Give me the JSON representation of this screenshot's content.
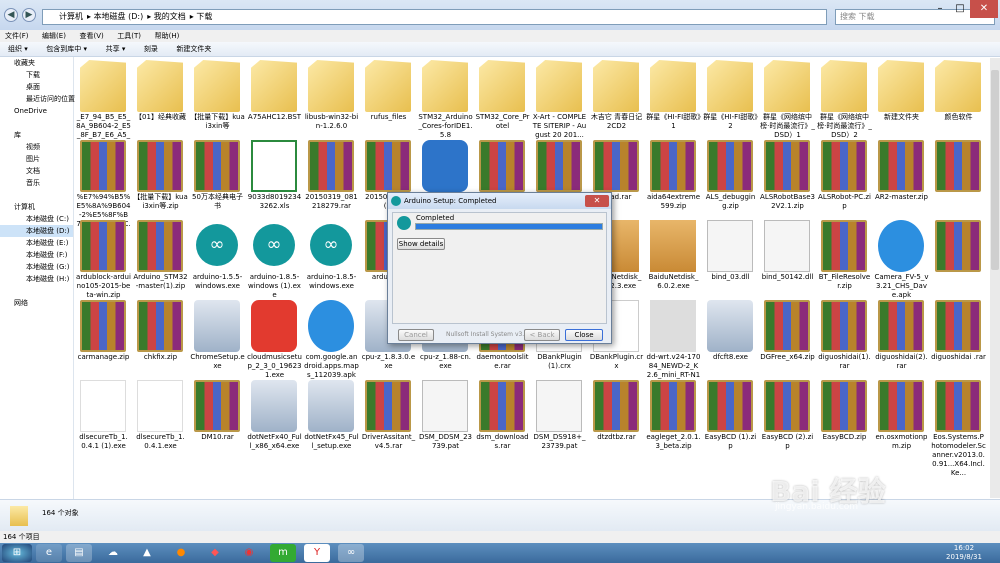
{
  "breadcrumb": [
    "计算机",
    "本地磁盘 (D:)",
    "我的文档",
    "下载"
  ],
  "search_placeholder": "搜索 下载",
  "menu": [
    "文件(F)",
    "编辑(E)",
    "查看(V)",
    "工具(T)",
    "帮助(H)"
  ],
  "toolbar": [
    "组织 ▾",
    "包含到库中 ▾",
    "共享 ▾",
    "刻录",
    "新建文件夹"
  ],
  "nav": [
    {
      "label": "收藏夹",
      "sub": false
    },
    {
      "label": "下载",
      "sub": true
    },
    {
      "label": "桌面",
      "sub": true
    },
    {
      "label": "最近访问的位置",
      "sub": true
    },
    {
      "label": "OneDrive",
      "sub": false
    },
    {
      "label": "",
      "sub": false
    },
    {
      "label": "库",
      "sub": false
    },
    {
      "label": "视频",
      "sub": true
    },
    {
      "label": "图片",
      "sub": true
    },
    {
      "label": "文档",
      "sub": true
    },
    {
      "label": "音乐",
      "sub": true
    },
    {
      "label": "",
      "sub": false
    },
    {
      "label": "计算机",
      "sub": false
    },
    {
      "label": "本地磁盘 (C:)",
      "sub": true
    },
    {
      "label": "本地磁盘 (D:)",
      "sub": true,
      "selected": true
    },
    {
      "label": "本地磁盘 (E:)",
      "sub": true
    },
    {
      "label": "本地磁盘 (F:)",
      "sub": true
    },
    {
      "label": "本地磁盘 (G:)",
      "sub": true
    },
    {
      "label": "本地磁盘 (H:)",
      "sub": true
    },
    {
      "label": "",
      "sub": false
    },
    {
      "label": "网络",
      "sub": false
    }
  ],
  "files": [
    {
      "name": "_E7_94_B5_E5_8A_9B604-2_E5_8F_B7_E6_A5_BC.dxf",
      "type": "folder"
    },
    {
      "name": "【01】经典收藏",
      "type": "folder"
    },
    {
      "name": "【批量下载】kuai3xin等",
      "type": "folder"
    },
    {
      "name": "A75AHC12.BST",
      "type": "folder"
    },
    {
      "name": "libusb-win32-bin-1.2.6.0",
      "type": "folder"
    },
    {
      "name": "rufus_files",
      "type": "folder"
    },
    {
      "name": "STM32_Arduino_Cores-forIDE1.5.8",
      "type": "folder"
    },
    {
      "name": "STM32_Core_Protel",
      "type": "folder"
    },
    {
      "name": "X-Art - COMPLETE SITERIP - August 20 201...",
      "type": "folder"
    },
    {
      "name": "木吉它 青春日记2CD2",
      "type": "folder"
    },
    {
      "name": "群星《HI-FI甜歌》1",
      "type": "folder"
    },
    {
      "name": "群星《HI-FI甜歌》2",
      "type": "folder"
    },
    {
      "name": "群星《网络缤中榜·时尚最流行》_DSD）1",
      "type": "folder"
    },
    {
      "name": "群星《网络缤中榜·时尚最流行》_DSD）2",
      "type": "folder"
    },
    {
      "name": "新建文件夹",
      "type": "folder"
    },
    {
      "name": "颜色软件",
      "type": "folder"
    },
    {
      "name": "%E7%94%B5%E5%8A%9B604-2%E5%8F%B7%E6%A5%BC.dx...",
      "type": "rar"
    },
    {
      "name": "【批量下载】kuai3xin等.zip",
      "type": "rar"
    },
    {
      "name": "50万本经典电子书",
      "type": "rar"
    },
    {
      "name": "9033d80192343262.xls",
      "type": "xls"
    },
    {
      "name": "20150319_081218279.rar",
      "type": "rar"
    },
    {
      "name": "2015031 440(...",
      "type": "rar"
    },
    {
      "name": "",
      "type": "qb"
    },
    {
      "name": "",
      "type": "rar"
    },
    {
      "name": "oneRead orate_11 33_Port oft.rar",
      "type": "rar"
    },
    {
      "name": "adad.rar",
      "type": "rar"
    },
    {
      "name": "aida64extreme599.zip",
      "type": "rar"
    },
    {
      "name": "ALS_debugging.zip",
      "type": "rar"
    },
    {
      "name": "ALSRobotBase32V2.1.zip",
      "type": "rar"
    },
    {
      "name": "ALSRobot-PC.zip",
      "type": "rar"
    },
    {
      "name": "AR2-master.zip",
      "type": "rar"
    },
    {
      "name": "",
      "type": "rar"
    },
    {
      "name": "ardublock-arduino105-2015-beta-win.zip",
      "type": "rar"
    },
    {
      "name": "Arduino_STM32-master(1).zip",
      "type": "rar"
    },
    {
      "name": "arduino-1.5.5-windows.exe",
      "type": "ard"
    },
    {
      "name": "arduino-1.8.5-windows (1).exe",
      "type": "ard"
    },
    {
      "name": "arduino-1.8.5-windows.exe",
      "type": "ard"
    },
    {
      "name": "arduino...",
      "type": "rar"
    },
    {
      "name": "",
      "type": "rar"
    },
    {
      "name": "",
      "type": "rar"
    },
    {
      "name": "music_s-1 0.exe",
      "type": "box"
    },
    {
      "name": "BaiduNetdisk_5.7.2.3.exe",
      "type": "box"
    },
    {
      "name": "BaiduNetdisk_6.0.2.exe",
      "type": "box"
    },
    {
      "name": "bind_03.dll",
      "type": "dll"
    },
    {
      "name": "bind_50142.dll",
      "type": "dll"
    },
    {
      "name": "BT_FileResolver.zip",
      "type": "rar"
    },
    {
      "name": "Camera_FV-5_v3.21_CHS_Dave.apk",
      "type": "apk"
    },
    {
      "name": "",
      "type": "rar"
    },
    {
      "name": "carmanage.zip",
      "type": "rar"
    },
    {
      "name": "chkfix.zip",
      "type": "rar"
    },
    {
      "name": "ChromeSetup.exe",
      "type": "setup"
    },
    {
      "name": "cloudmusicsetup_2_3_0_196231.exe",
      "type": "music"
    },
    {
      "name": "com.google.android.apps.maps_112039.apk",
      "type": "apk"
    },
    {
      "name": "cpu-z_1.8.3.0.exe",
      "type": "setup"
    },
    {
      "name": "cpu-z_1.88-cn.exe",
      "type": "setup"
    },
    {
      "name": "daemontoolslite.rar",
      "type": "rar"
    },
    {
      "name": "DBankPlugin(1).crx",
      "type": "crx"
    },
    {
      "name": "DBankPlugin.crx",
      "type": "crx"
    },
    {
      "name": "dd-wrt.v24-17084_NEWD-2_K2.6_mini_RT-N12B1.trx",
      "type": "trx"
    },
    {
      "name": "dfcft8.exe",
      "type": "setup"
    },
    {
      "name": "DGFree_x64.zip",
      "type": "rar"
    },
    {
      "name": "diguoshidai(1).rar",
      "type": "rar"
    },
    {
      "name": "diguoshidai(2).rar",
      "type": "rar"
    },
    {
      "name": "diguoshidai .rar",
      "type": "rar"
    },
    {
      "name": "dlsecureTb_1.0.4.1 (1).exe",
      "type": "plus"
    },
    {
      "name": "dlsecureTb_1.0.4.1.exe",
      "type": "plus"
    },
    {
      "name": "DM10.rar",
      "type": "rar"
    },
    {
      "name": "dotNetFx40_Full_x86_x64.exe",
      "type": "setup"
    },
    {
      "name": "dotNetFx45_Full_setup.exe",
      "type": "setup"
    },
    {
      "name": "DriverAssitant_v4.5.rar",
      "type": "rar"
    },
    {
      "name": "DSM_DDSM_23739.pat",
      "type": "dll"
    },
    {
      "name": "dsm_download s.rar",
      "type": "rar"
    },
    {
      "name": "DSM_DS918+_23739.pat",
      "type": "dll"
    },
    {
      "name": "dtzdtbz.rar",
      "type": "rar"
    },
    {
      "name": "eagleget_2.0.1.3_beta.zip",
      "type": "rar"
    },
    {
      "name": "EasyBCD (1).zip",
      "type": "rar"
    },
    {
      "name": "EasyBCD (2).zip",
      "type": "rar"
    },
    {
      "name": "EasyBCD.zip",
      "type": "rar"
    },
    {
      "name": "en.osxmotionpm.zip",
      "type": "rar"
    },
    {
      "name": "Eos.Systems.Photomodeler.Scanner.v2013.0.0.91...X64.Incl.Ke...",
      "type": "rar"
    }
  ],
  "dialog": {
    "title": "Arduino Setup: Completed",
    "status": "Completed",
    "progress": 1.0,
    "show_details": "Show details",
    "footer": "Nullsoft Install System v3.0",
    "cancel": "Cancel",
    "back": "< Back",
    "close": "Close"
  },
  "details": {
    "count": "164 个对象"
  },
  "status": {
    "count": "164 个项目"
  },
  "clock": {
    "time": "16:02",
    "date": "2019/8/31"
  },
  "watermark": {
    "logo": "Bai 经验",
    "url": "jingyan.baidu.com"
  },
  "colors": {
    "arduino": "#13989c",
    "taskbar": "#3a6a9c",
    "progress": "#2c7de0"
  }
}
